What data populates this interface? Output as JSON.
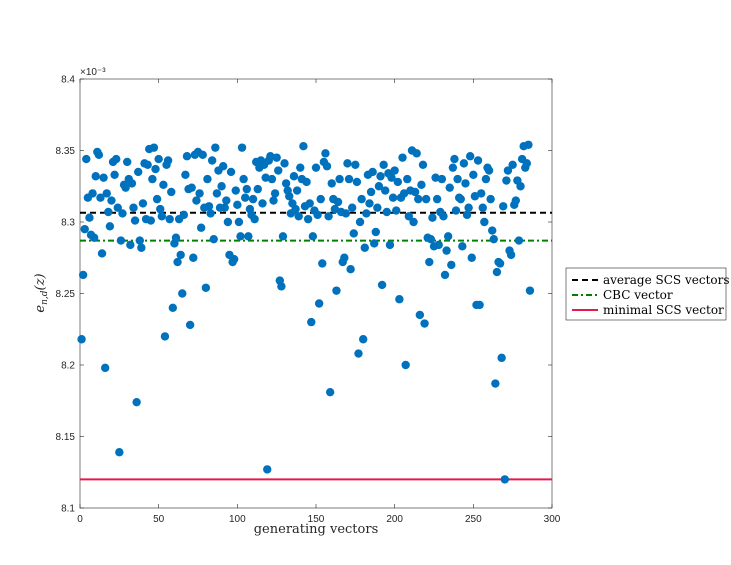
{
  "chart_data": {
    "type": "scatter",
    "xlabel": "generating vectors",
    "ylabel": "e_{n,d}(z)",
    "exponent_label": "×10⁻³",
    "xlim": [
      0,
      300
    ],
    "ylim": [
      8.1,
      8.4
    ],
    "xticks": [
      0,
      50,
      100,
      150,
      200,
      250,
      300
    ],
    "yticks": [
      8.1,
      8.15,
      8.2,
      8.25,
      8.3,
      8.35,
      8.4
    ],
    "ytick_labels": [
      "8.1",
      "8.15",
      "8.2",
      "8.25",
      "8.3",
      "8.35",
      "8.4"
    ],
    "grid": false,
    "legend_placement": "outside-right",
    "colors": {
      "points": "#0072BD",
      "average": "#000000",
      "cbc": "#008000",
      "minimal": "#E5194A"
    },
    "lines": [
      {
        "name": "average SCS vectors",
        "y": 8.3065,
        "style": "dashed"
      },
      {
        "name": "CBC vector",
        "y": 8.287,
        "style": "dashdot"
      },
      {
        "name": "minimal SCS vector",
        "y": 8.12,
        "style": "solid"
      }
    ],
    "points": [
      [
        1,
        8.218
      ],
      [
        2,
        8.263
      ],
      [
        3,
        8.295
      ],
      [
        4,
        8.344
      ],
      [
        5,
        8.317
      ],
      [
        6,
        8.303
      ],
      [
        7,
        8.291
      ],
      [
        8,
        8.32
      ],
      [
        9,
        8.289
      ],
      [
        10,
        8.332
      ],
      [
        11,
        8.349
      ],
      [
        12,
        8.347
      ],
      [
        13,
        8.317
      ],
      [
        14,
        8.278
      ],
      [
        15,
        8.331
      ],
      [
        16,
        8.198
      ],
      [
        17,
        8.32
      ],
      [
        18,
        8.307
      ],
      [
        19,
        8.297
      ],
      [
        20,
        8.315
      ],
      [
        21,
        8.342
      ],
      [
        22,
        8.333
      ],
      [
        23,
        8.344
      ],
      [
        24,
        8.31
      ],
      [
        25,
        8.139
      ],
      [
        26,
        8.287
      ],
      [
        27,
        8.306
      ],
      [
        28,
        8.326
      ],
      [
        29,
        8.324
      ],
      [
        30,
        8.342
      ],
      [
        31,
        8.33
      ],
      [
        32,
        8.284
      ],
      [
        33,
        8.327
      ],
      [
        34,
        8.31
      ],
      [
        35,
        8.301
      ],
      [
        36,
        8.174
      ],
      [
        37,
        8.335
      ],
      [
        38,
        8.287
      ],
      [
        39,
        8.282
      ],
      [
        40,
        8.313
      ],
      [
        41,
        8.341
      ],
      [
        42,
        8.302
      ],
      [
        43,
        8.34
      ],
      [
        44,
        8.351
      ],
      [
        45,
        8.301
      ],
      [
        46,
        8.33
      ],
      [
        47,
        8.352
      ],
      [
        48,
        8.337
      ],
      [
        49,
        8.316
      ],
      [
        50,
        8.344
      ],
      [
        51,
        8.309
      ],
      [
        52,
        8.304
      ],
      [
        53,
        8.326
      ],
      [
        54,
        8.22
      ],
      [
        55,
        8.34
      ],
      [
        56,
        8.343
      ],
      [
        57,
        8.302
      ],
      [
        58,
        8.321
      ],
      [
        59,
        8.24
      ],
      [
        60,
        8.285
      ],
      [
        61,
        8.289
      ],
      [
        62,
        8.272
      ],
      [
        63,
        8.302
      ],
      [
        64,
        8.277
      ],
      [
        65,
        8.25
      ],
      [
        66,
        8.305
      ],
      [
        67,
        8.333
      ],
      [
        68,
        8.346
      ],
      [
        69,
        8.323
      ],
      [
        70,
        8.228
      ],
      [
        71,
        8.324
      ],
      [
        72,
        8.275
      ],
      [
        73,
        8.347
      ],
      [
        74,
        8.315
      ],
      [
        75,
        8.349
      ],
      [
        76,
        8.32
      ],
      [
        77,
        8.296
      ],
      [
        78,
        8.347
      ],
      [
        79,
        8.31
      ],
      [
        80,
        8.254
      ],
      [
        81,
        8.33
      ],
      [
        82,
        8.311
      ],
      [
        83,
        8.306
      ],
      [
        84,
        8.343
      ],
      [
        85,
        8.288
      ],
      [
        86,
        8.352
      ],
      [
        87,
        8.32
      ],
      [
        88,
        8.336
      ],
      [
        89,
        8.31
      ],
      [
        90,
        8.325
      ],
      [
        91,
        8.339
      ],
      [
        92,
        8.31
      ],
      [
        93,
        8.315
      ],
      [
        94,
        8.3
      ],
      [
        95,
        8.277
      ],
      [
        96,
        8.335
      ],
      [
        97,
        8.272
      ],
      [
        98,
        8.274
      ],
      [
        99,
        8.322
      ],
      [
        100,
        8.312
      ],
      [
        101,
        8.3
      ],
      [
        102,
        8.29
      ],
      [
        103,
        8.352
      ],
      [
        104,
        8.33
      ],
      [
        105,
        8.317
      ],
      [
        106,
        8.323
      ],
      [
        107,
        8.29
      ],
      [
        108,
        8.309
      ],
      [
        109,
        8.305
      ],
      [
        110,
        8.316
      ],
      [
        111,
        8.302
      ],
      [
        112,
        8.342
      ],
      [
        113,
        8.323
      ],
      [
        114,
        8.338
      ],
      [
        115,
        8.343
      ],
      [
        116,
        8.313
      ],
      [
        117,
        8.34
      ],
      [
        118,
        8.331
      ],
      [
        119,
        8.127
      ],
      [
        120,
        8.343
      ],
      [
        121,
        8.346
      ],
      [
        122,
        8.33
      ],
      [
        123,
        8.315
      ],
      [
        124,
        8.32
      ],
      [
        125,
        8.345
      ],
      [
        126,
        8.336
      ],
      [
        127,
        8.259
      ],
      [
        128,
        8.255
      ],
      [
        129,
        8.29
      ],
      [
        130,
        8.341
      ],
      [
        131,
        8.327
      ],
      [
        132,
        8.322
      ],
      [
        133,
        8.318
      ],
      [
        134,
        8.306
      ],
      [
        135,
        8.313
      ],
      [
        136,
        8.332
      ],
      [
        137,
        8.309
      ],
      [
        138,
        8.322
      ],
      [
        139,
        8.304
      ],
      [
        140,
        8.338
      ],
      [
        141,
        8.33
      ],
      [
        142,
        8.353
      ],
      [
        143,
        8.311
      ],
      [
        144,
        8.328
      ],
      [
        145,
        8.302
      ],
      [
        146,
        8.313
      ],
      [
        147,
        8.23
      ],
      [
        148,
        8.29
      ],
      [
        149,
        8.308
      ],
      [
        150,
        8.338
      ],
      [
        151,
        8.305
      ],
      [
        152,
        8.243
      ],
      [
        153,
        8.316
      ],
      [
        154,
        8.271
      ],
      [
        155,
        8.342
      ],
      [
        156,
        8.348
      ],
      [
        157,
        8.339
      ],
      [
        158,
        8.304
      ],
      [
        159,
        8.181
      ],
      [
        160,
        8.327
      ],
      [
        161,
        8.316
      ],
      [
        162,
        8.309
      ],
      [
        163,
        8.252
      ],
      [
        164,
        8.314
      ],
      [
        165,
        8.33
      ],
      [
        166,
        8.307
      ],
      [
        167,
        8.272
      ],
      [
        168,
        8.275
      ],
      [
        169,
        8.306
      ],
      [
        170,
        8.341
      ],
      [
        171,
        8.33
      ],
      [
        172,
        8.267
      ],
      [
        173,
        8.31
      ],
      [
        174,
        8.292
      ],
      [
        175,
        8.34
      ],
      [
        176,
        8.328
      ],
      [
        177,
        8.208
      ],
      [
        178,
        8.3
      ],
      [
        179,
        8.316
      ],
      [
        180,
        8.218
      ],
      [
        181,
        8.282
      ],
      [
        182,
        8.306
      ],
      [
        183,
        8.333
      ],
      [
        184,
        8.313
      ],
      [
        185,
        8.321
      ],
      [
        186,
        8.335
      ],
      [
        187,
        8.285
      ],
      [
        188,
        8.293
      ],
      [
        189,
        8.31
      ],
      [
        190,
        8.325
      ],
      [
        191,
        8.332
      ],
      [
        192,
        8.256
      ],
      [
        193,
        8.34
      ],
      [
        194,
        8.322
      ],
      [
        195,
        8.307
      ],
      [
        196,
        8.334
      ],
      [
        197,
        8.284
      ],
      [
        198,
        8.331
      ],
      [
        199,
        8.317
      ],
      [
        200,
        8.336
      ],
      [
        201,
        8.308
      ],
      [
        202,
        8.328
      ],
      [
        203,
        8.246
      ],
      [
        204,
        8.317
      ],
      [
        205,
        8.345
      ],
      [
        206,
        8.32
      ],
      [
        207,
        8.2
      ],
      [
        208,
        8.33
      ],
      [
        209,
        8.304
      ],
      [
        210,
        8.322
      ],
      [
        211,
        8.35
      ],
      [
        212,
        8.3
      ],
      [
        213,
        8.321
      ],
      [
        214,
        8.348
      ],
      [
        215,
        8.316
      ],
      [
        216,
        8.235
      ],
      [
        217,
        8.326
      ],
      [
        218,
        8.34
      ],
      [
        219,
        8.229
      ],
      [
        220,
        8.316
      ],
      [
        221,
        8.289
      ],
      [
        222,
        8.272
      ],
      [
        223,
        8.288
      ],
      [
        224,
        8.303
      ],
      [
        225,
        8.283
      ],
      [
        226,
        8.331
      ],
      [
        227,
        8.316
      ],
      [
        228,
        8.284
      ],
      [
        229,
        8.307
      ],
      [
        230,
        8.33
      ],
      [
        231,
        8.304
      ],
      [
        232,
        8.263
      ],
      [
        233,
        8.28
      ],
      [
        234,
        8.29
      ],
      [
        235,
        8.324
      ],
      [
        236,
        8.27
      ],
      [
        237,
        8.338
      ],
      [
        238,
        8.344
      ],
      [
        239,
        8.308
      ],
      [
        240,
        8.33
      ],
      [
        241,
        8.317
      ],
      [
        242,
        8.316
      ],
      [
        243,
        8.283
      ],
      [
        244,
        8.341
      ],
      [
        245,
        8.327
      ],
      [
        246,
        8.305
      ],
      [
        247,
        8.31
      ],
      [
        248,
        8.346
      ],
      [
        249,
        8.275
      ],
      [
        250,
        8.333
      ],
      [
        251,
        8.318
      ],
      [
        252,
        8.242
      ],
      [
        253,
        8.343
      ],
      [
        254,
        8.242
      ],
      [
        255,
        8.32
      ],
      [
        256,
        8.31
      ],
      [
        257,
        8.3
      ],
      [
        258,
        8.33
      ],
      [
        259,
        8.338
      ],
      [
        260,
        8.336
      ],
      [
        261,
        8.316
      ],
      [
        262,
        8.294
      ],
      [
        263,
        8.288
      ],
      [
        264,
        8.187
      ],
      [
        265,
        8.265
      ],
      [
        266,
        8.272
      ],
      [
        267,
        8.271
      ],
      [
        268,
        8.205
      ],
      [
        269,
        8.311
      ],
      [
        270,
        8.12
      ],
      [
        271,
        8.329
      ],
      [
        272,
        8.336
      ],
      [
        273,
        8.28
      ],
      [
        274,
        8.277
      ],
      [
        275,
        8.34
      ],
      [
        276,
        8.312
      ],
      [
        277,
        8.315
      ],
      [
        278,
        8.329
      ],
      [
        279,
        8.287
      ],
      [
        280,
        8.325
      ],
      [
        281,
        8.344
      ],
      [
        282,
        8.353
      ],
      [
        283,
        8.338
      ],
      [
        284,
        8.341
      ],
      [
        285,
        8.354
      ],
      [
        286,
        8.252
      ]
    ]
  }
}
